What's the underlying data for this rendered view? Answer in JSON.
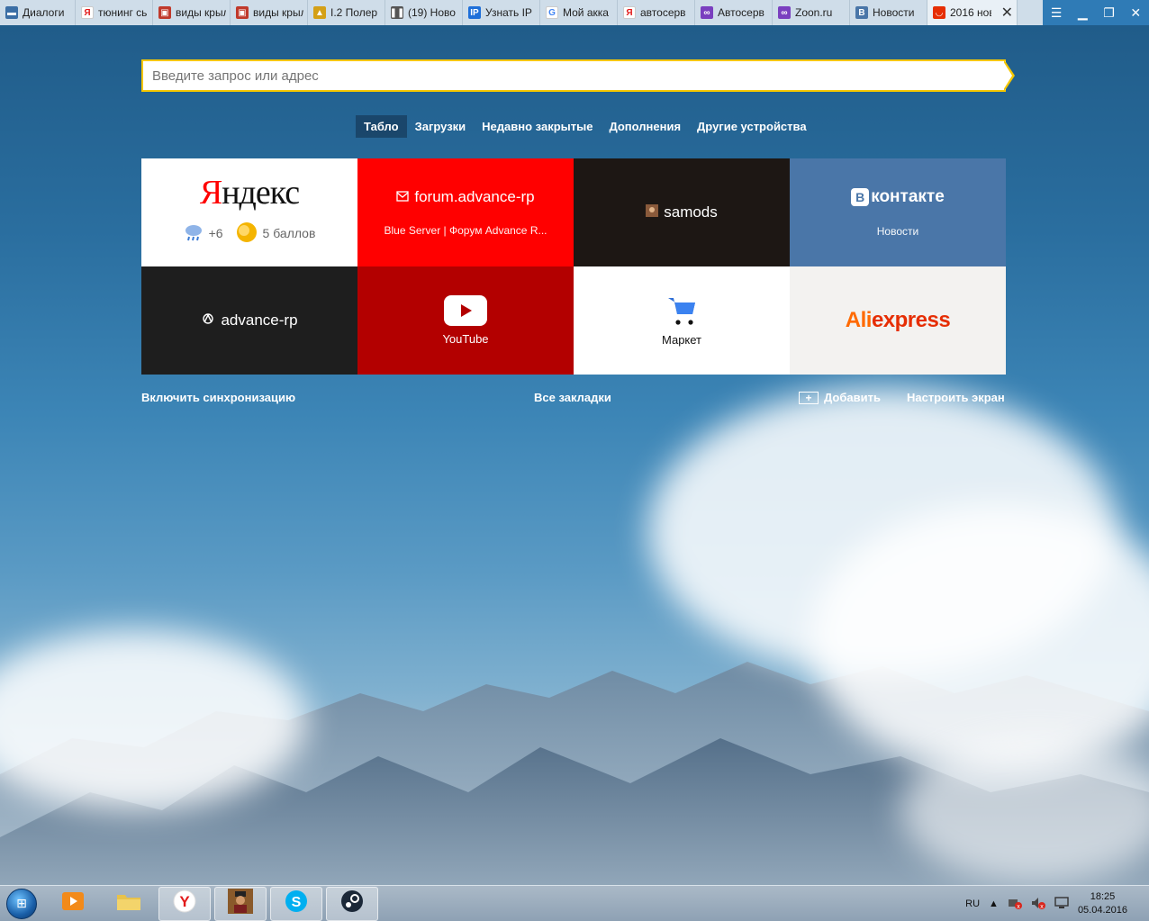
{
  "tabs": [
    {
      "label": "Диалоги",
      "icon": "message-icon",
      "color": "#3b6ea5"
    },
    {
      "label": "тюнинг сь",
      "icon": "yandex-icon",
      "color": "#ffffff"
    },
    {
      "label": "виды крыл",
      "icon": "image-icon",
      "color": "#c0392b"
    },
    {
      "label": "виды крыл",
      "icon": "image-icon",
      "color": "#c0392b"
    },
    {
      "label": "I.2 Полер",
      "icon": "hat-icon",
      "color": "#d4a017"
    },
    {
      "label": "(19) Ново",
      "icon": "pause-icon",
      "color": "#555555"
    },
    {
      "label": "Узнать IP",
      "icon": "ip-icon",
      "color": "#1e6fd9"
    },
    {
      "label": "Мой акка",
      "icon": "google-icon",
      "color": "#ffffff"
    },
    {
      "label": "автосерв",
      "icon": "yandex-icon",
      "color": "#ffffff"
    },
    {
      "label": "Автосерв",
      "icon": "zoon-icon",
      "color": "#7a3fbf"
    },
    {
      "label": "Zoon.ru",
      "icon": "zoon-icon",
      "color": "#7a3fbf"
    },
    {
      "label": "Новости",
      "icon": "vk-icon",
      "color": "#4a76a8"
    },
    {
      "label": "2016 нов",
      "icon": "aliexpress-icon",
      "color": "#e62e04"
    }
  ],
  "search": {
    "placeholder": "Введите запрос или адрес"
  },
  "nav": [
    "Табло",
    "Загрузки",
    "Недавно закрытые",
    "Дополнения",
    "Другие устройства"
  ],
  "tiles": {
    "yandex": {
      "logo_first": "Я",
      "logo_rest": "ндекс",
      "weather": "+6",
      "traffic": "5 баллов"
    },
    "forum": {
      "title": "forum.advance-rp",
      "subtitle": "Blue Server | Форум Advance R..."
    },
    "samods": {
      "title": "samods"
    },
    "vk": {
      "logo": "контакте",
      "subtitle": "Новости"
    },
    "advance": {
      "title": "advance-rp"
    },
    "youtube": {
      "title": "YouTube"
    },
    "market": {
      "title": "Маркет"
    },
    "aliexpress": {
      "ali": "Ali",
      "x": "express"
    }
  },
  "bottom": {
    "sync": "Включить синхронизацию",
    "bookmarks": "Все закладки",
    "add": "Добавить",
    "customize": "Настроить экран"
  },
  "taskbar": {
    "lang": "RU",
    "time": "18:25",
    "date": "05.04.2016"
  }
}
